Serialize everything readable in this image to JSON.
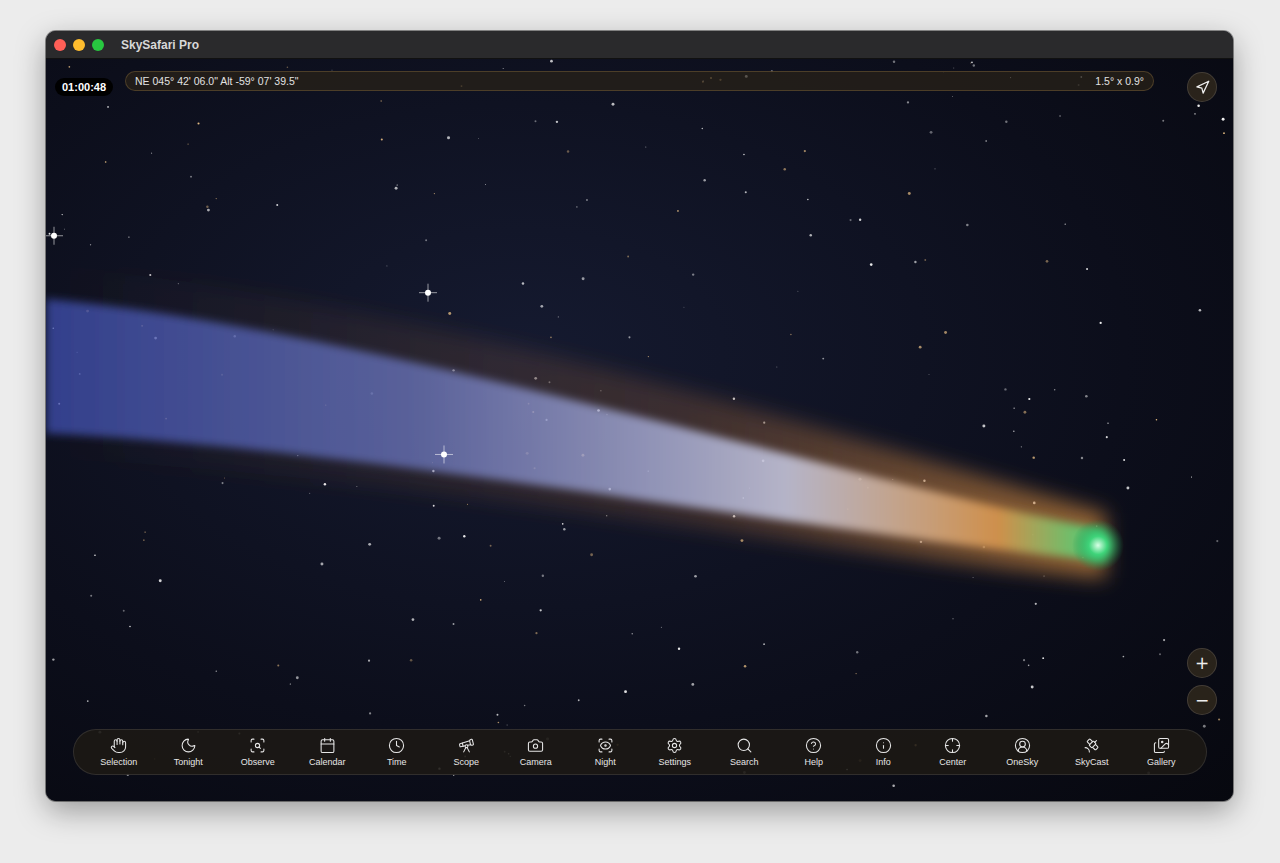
{
  "window": {
    "title": "SkySafari Pro"
  },
  "clock": "01:00:48",
  "status_bar": {
    "position": "NE 045° 42' 06.0\" Alt -59° 07' 39.5\"",
    "field_of_view": "1.5° x 0.9°"
  },
  "zoom_buttons": [
    "+",
    "−"
  ],
  "toolbar": [
    {
      "label": "Selection"
    },
    {
      "label": "Tonight"
    },
    {
      "label": "Observe"
    },
    {
      "label": "Calendar"
    },
    {
      "label": "Time"
    },
    {
      "label": "Scope"
    },
    {
      "label": "Camera"
    },
    {
      "label": "Night"
    },
    {
      "label": "Settings"
    },
    {
      "label": "Search"
    },
    {
      "label": "Help"
    },
    {
      "label": "Info"
    },
    {
      "label": "Center"
    },
    {
      "label": "OneSky"
    },
    {
      "label": "SkyCast"
    },
    {
      "label": "Gallery"
    }
  ]
}
